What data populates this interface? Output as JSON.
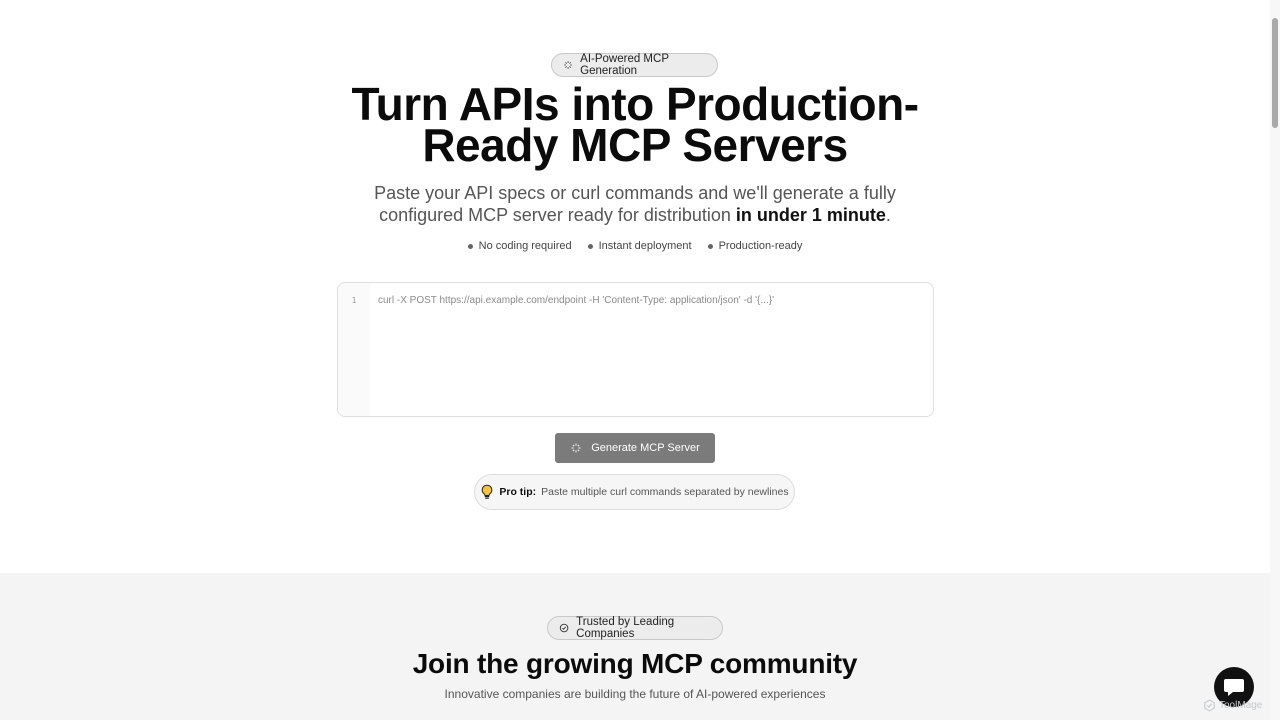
{
  "hero": {
    "badge": "AI-Powered MCP Generation",
    "headline_line1": "Turn APIs into Production-",
    "headline_line2": "Ready MCP Servers",
    "subtitle_text": "Paste your API specs or curl commands and we'll generate a fully configured MCP server ready for distribution ",
    "subtitle_emphasis": "in under 1 minute",
    "subtitle_end": ".",
    "features": [
      "No coding required",
      "Instant deployment",
      "Production-ready"
    ]
  },
  "editor": {
    "line_number": "1",
    "placeholder": "curl -X POST https://api.example.com/endpoint -H 'Content-Type: application/json' -d '{...}'"
  },
  "actions": {
    "generate_label": "Generate MCP Server"
  },
  "tip": {
    "label": "Pro tip:",
    "text": "Paste multiple curl commands separated by newlines"
  },
  "community": {
    "badge": "Trusted by Leading Companies",
    "title": "Join the growing MCP community",
    "subtitle": "Innovative companies are building the future of AI-powered experiences"
  },
  "watermark": "ToolMage",
  "icons": {
    "badge": "sparkle-icon",
    "generate": "sparkle-icon",
    "tip": "lightbulb-icon",
    "trust": "check-circle-icon",
    "chat": "chat-icon"
  }
}
